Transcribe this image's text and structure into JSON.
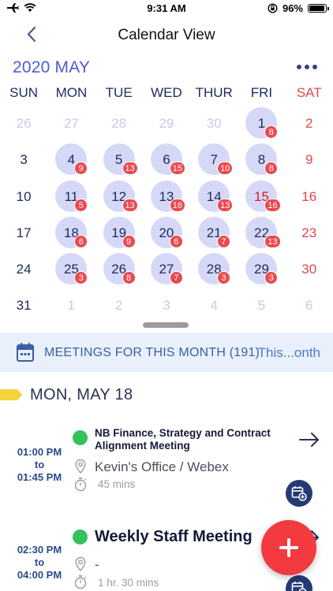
{
  "status_bar": {
    "time": "9:31 AM",
    "battery_percent": "96%",
    "battery_level": 0.96
  },
  "nav": {
    "title": "Calendar View"
  },
  "calendar": {
    "month_title": "2020 MAY",
    "weekdays": [
      "SUN",
      "MON",
      "TUE",
      "WED",
      "THUR",
      "FRI",
      "SAT"
    ],
    "weeks": [
      [
        {
          "d": "26",
          "other": true
        },
        {
          "d": "27",
          "other": true
        },
        {
          "d": "28",
          "other": true
        },
        {
          "d": "29",
          "other": true
        },
        {
          "d": "30",
          "other": true
        },
        {
          "d": "1",
          "bubble": true,
          "badge": "8"
        },
        {
          "d": "2",
          "sat": true
        }
      ],
      [
        {
          "d": "3"
        },
        {
          "d": "4",
          "bubble": true,
          "badge": "9"
        },
        {
          "d": "5",
          "bubble": true,
          "badge": "13"
        },
        {
          "d": "6",
          "bubble": true,
          "badge": "15"
        },
        {
          "d": "7",
          "bubble": true,
          "badge": "10"
        },
        {
          "d": "8",
          "bubble": true,
          "badge": "8"
        },
        {
          "d": "9",
          "sat": true
        }
      ],
      [
        {
          "d": "10"
        },
        {
          "d": "11",
          "bubble": true,
          "badge": "5"
        },
        {
          "d": "12",
          "bubble": true,
          "badge": "13"
        },
        {
          "d": "13",
          "bubble": true,
          "badge": "16"
        },
        {
          "d": "14",
          "bubble": true,
          "badge": "13"
        },
        {
          "d": "15",
          "today": true,
          "badge": "16"
        },
        {
          "d": "16",
          "sat": true
        }
      ],
      [
        {
          "d": "17"
        },
        {
          "d": "18",
          "bubble": true,
          "badge": "6"
        },
        {
          "d": "19",
          "bubble": true,
          "badge": "9"
        },
        {
          "d": "20",
          "bubble": true,
          "badge": "6"
        },
        {
          "d": "21",
          "bubble": true,
          "badge": "7"
        },
        {
          "d": "22",
          "bubble": true,
          "badge": "13"
        },
        {
          "d": "23",
          "sat": true
        }
      ],
      [
        {
          "d": "24"
        },
        {
          "d": "25",
          "bubble": true,
          "badge": "3"
        },
        {
          "d": "26",
          "bubble": true,
          "badge": "8"
        },
        {
          "d": "27",
          "bubble": true,
          "badge": "7"
        },
        {
          "d": "28",
          "bubble": true,
          "badge": "3"
        },
        {
          "d": "29",
          "bubble": true,
          "badge": "3"
        },
        {
          "d": "30",
          "sat": true
        }
      ],
      [
        {
          "d": "31"
        },
        {
          "d": "1",
          "other": true
        },
        {
          "d": "2",
          "other": true
        },
        {
          "d": "3",
          "other": true
        },
        {
          "d": "4",
          "other": true
        },
        {
          "d": "5",
          "other": true
        },
        {
          "d": "6",
          "other": true
        }
      ]
    ]
  },
  "banner": {
    "label": "MEETINGS FOR THIS MONTH (191)",
    "filter": "This...onth"
  },
  "day_section": {
    "title": "MON, MAY 18"
  },
  "events": [
    {
      "start": "01:00 PM",
      "to": "to",
      "end": "01:45 PM",
      "title": "NB Finance, Strategy and Contract Alignment Meeting",
      "location": "Kevin's Office / Webex",
      "duration": "45 mins",
      "status_color": "#35c25a"
    },
    {
      "start": "02:30 PM",
      "to": "to",
      "end": "04:00 PM",
      "title": "Weekly Staff Meeting",
      "location": "-",
      "duration": "1 hr. 30 mins",
      "status_color": "#35c25a"
    }
  ],
  "colors": {
    "accent": "#4f5bd5",
    "saturday": "#e2474c",
    "badge": "#ea4a4f",
    "bubble": "#d5d9f7",
    "fab": "#f23a3f"
  },
  "icons": [
    "airplane-icon",
    "wifi-icon",
    "orientation-lock-icon",
    "battery-icon",
    "back-chevron-icon",
    "more-dots-icon",
    "calendar-icon",
    "pin-icon",
    "timer-icon",
    "arrow-right-icon",
    "calendar-add-icon",
    "plus-icon"
  ]
}
